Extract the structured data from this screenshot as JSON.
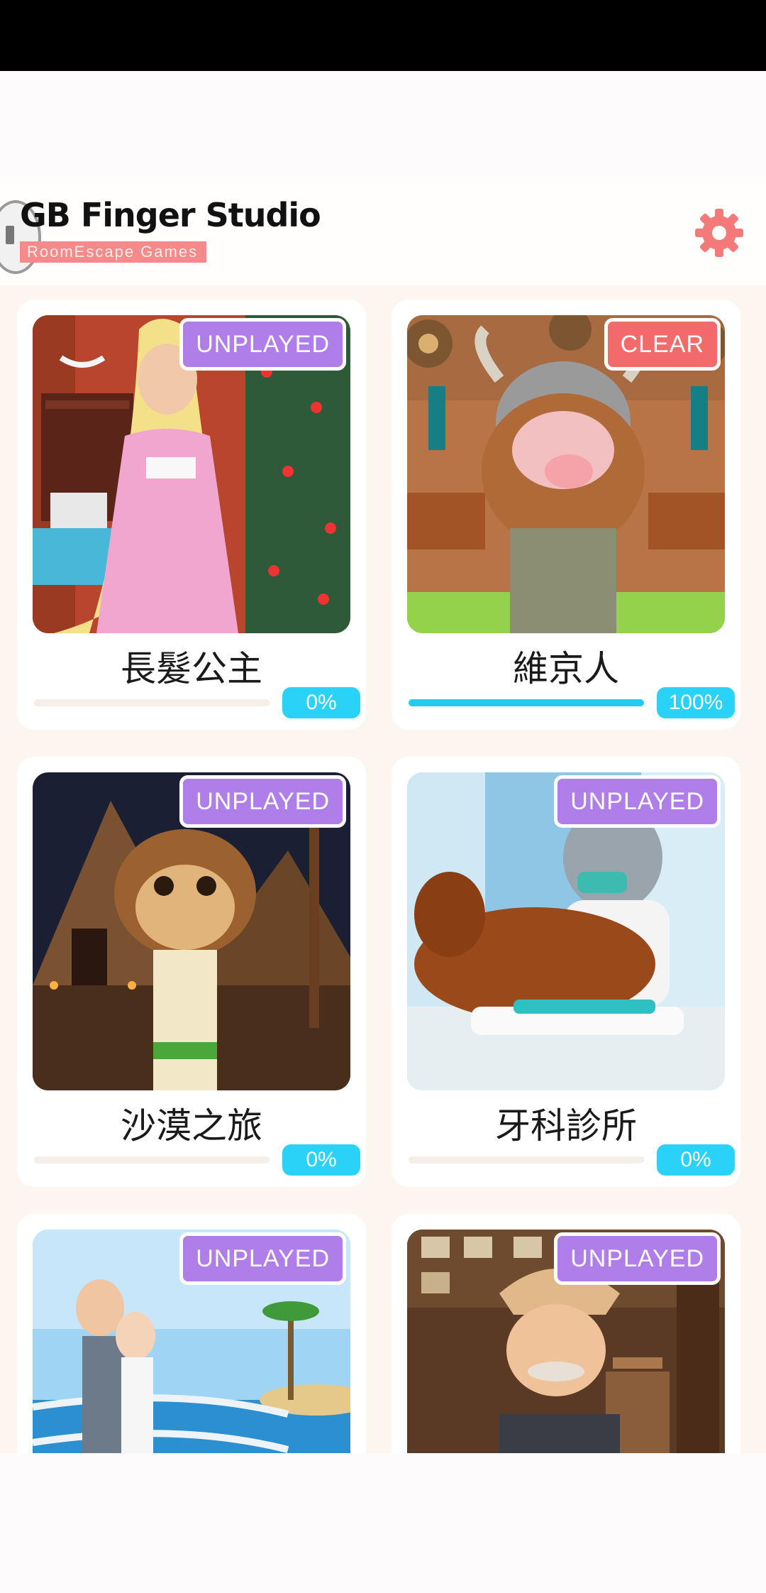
{
  "header": {
    "title": "GB Finger Studio",
    "subtitle": "RoomEscape  Games",
    "settings_icon": "gear-icon"
  },
  "colors": {
    "unplayed_badge": "#b07ee8",
    "clear_badge": "#f26b6b",
    "progress": "#23cbf2",
    "gear": "#f47a7a"
  },
  "games": [
    {
      "title": "長髮公主",
      "badge": "UNPLAYED",
      "progress_label": "0%",
      "progress": 0
    },
    {
      "title": "維京人",
      "badge": "CLEAR",
      "progress_label": "100%",
      "progress": 1
    },
    {
      "title": "沙漠之旅",
      "badge": "UNPLAYED",
      "progress_label": "0%",
      "progress": 0
    },
    {
      "title": "牙科診所",
      "badge": "UNPLAYED",
      "progress_label": "0%",
      "progress": 0
    },
    {
      "title": "",
      "badge": "UNPLAYED"
    },
    {
      "title": "",
      "badge": "UNPLAYED"
    }
  ]
}
